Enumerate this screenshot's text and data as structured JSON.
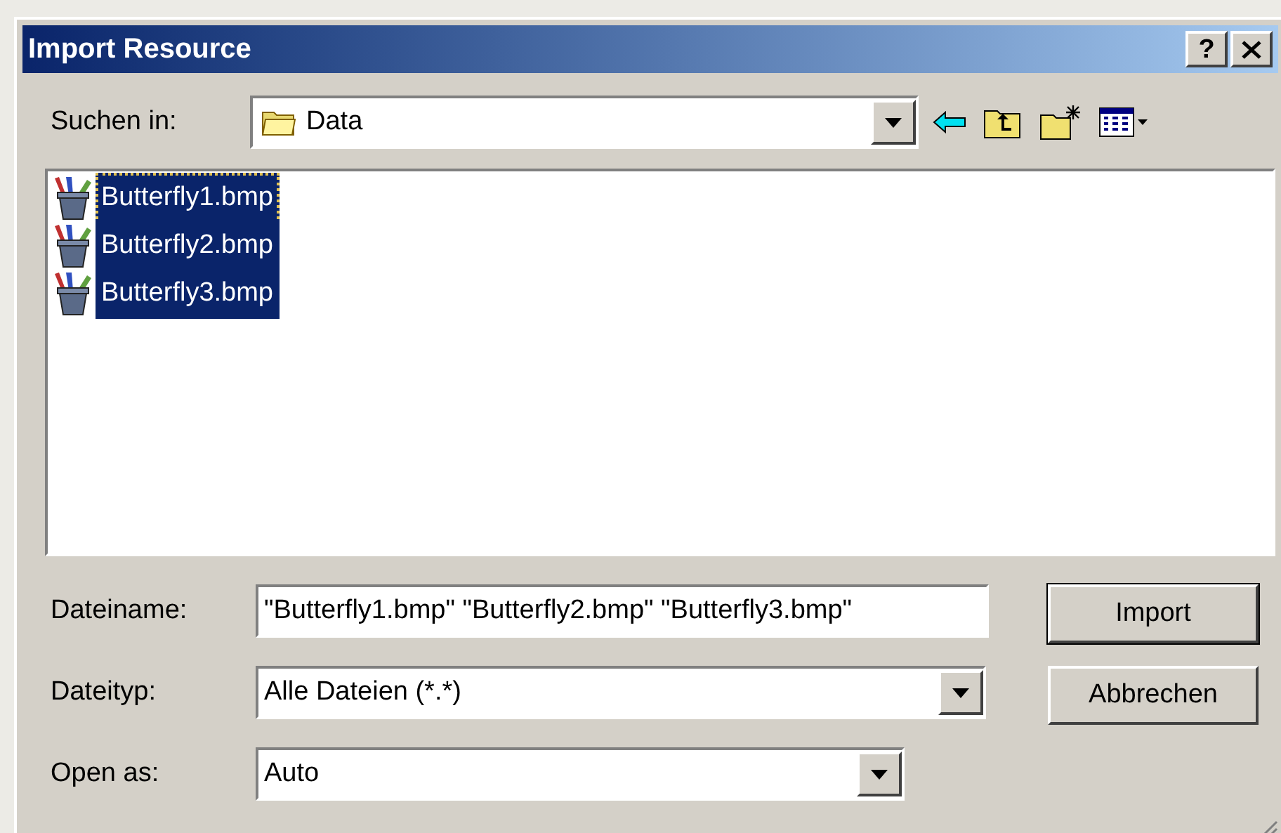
{
  "window": {
    "title": "Import Resource",
    "help_button": "?"
  },
  "look_in": {
    "label": "Suchen in:",
    "value": "Data"
  },
  "files": [
    {
      "name": "Butterfly1.bmp",
      "selected": true,
      "focused": true
    },
    {
      "name": "Butterfly2.bmp",
      "selected": true,
      "focused": false
    },
    {
      "name": "Butterfly3.bmp",
      "selected": true,
      "focused": false
    }
  ],
  "fields": [
    {
      "kind": "text",
      "label": "Dateiname:",
      "value": "\"Butterfly1.bmp\" \"Butterfly2.bmp\" \"Butterfly3.bmp\""
    },
    {
      "kind": "dropdown",
      "label": "Dateityp:",
      "value": "Alle Dateien (*.*)"
    },
    {
      "kind": "dropdown",
      "label": "Open as:",
      "value": "Auto"
    }
  ],
  "buttons": [
    {
      "label": "Import",
      "default": true
    },
    {
      "label": "Abbrechen",
      "default": false
    }
  ]
}
